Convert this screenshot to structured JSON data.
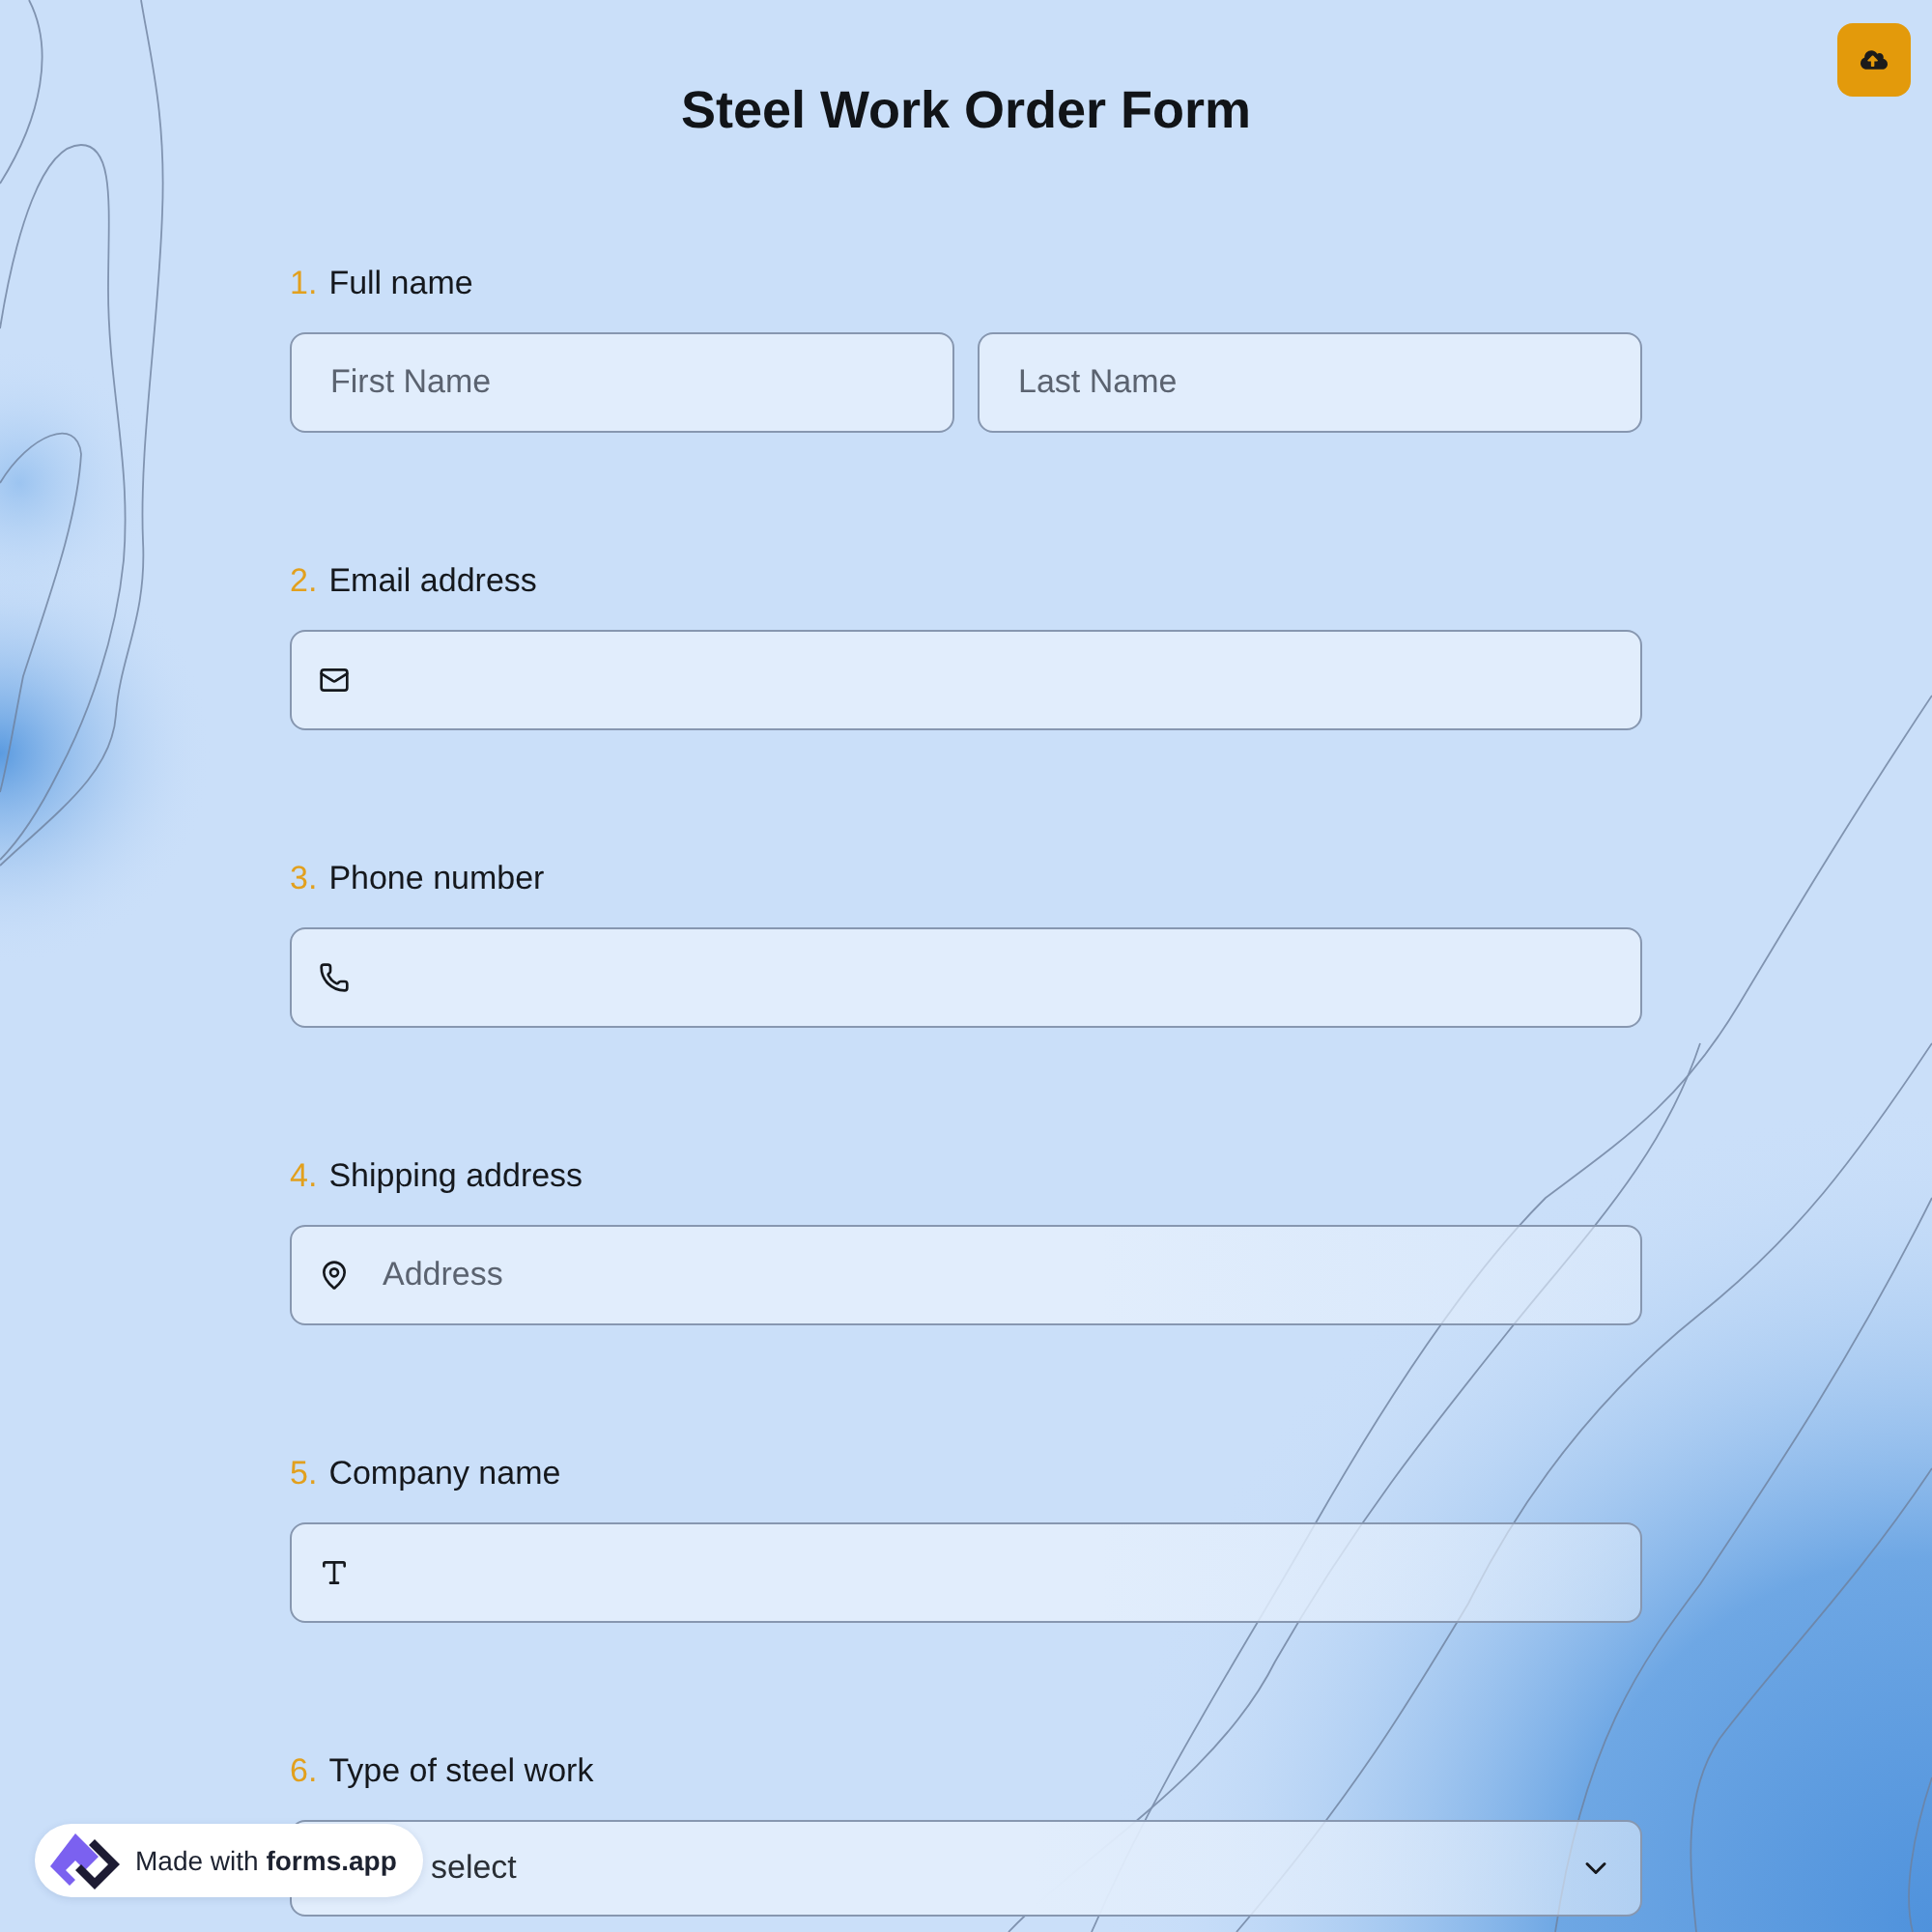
{
  "title": "Steel Work Order Form",
  "questions": [
    {
      "number": "1.",
      "label": "Full name",
      "kind": "name",
      "fields": [
        {
          "placeholder": "First Name"
        },
        {
          "placeholder": "Last Name"
        }
      ]
    },
    {
      "number": "2.",
      "label": "Email address",
      "kind": "email"
    },
    {
      "number": "3.",
      "label": "Phone number",
      "kind": "phone"
    },
    {
      "number": "4.",
      "label": "Shipping address",
      "kind": "address",
      "placeholder": "Address"
    },
    {
      "number": "5.",
      "label": "Company name",
      "kind": "text"
    },
    {
      "number": "6.",
      "label": "Type of steel work",
      "kind": "select",
      "placeholder": "select"
    }
  ],
  "badge": {
    "text": "Made with **forms.app**"
  }
}
